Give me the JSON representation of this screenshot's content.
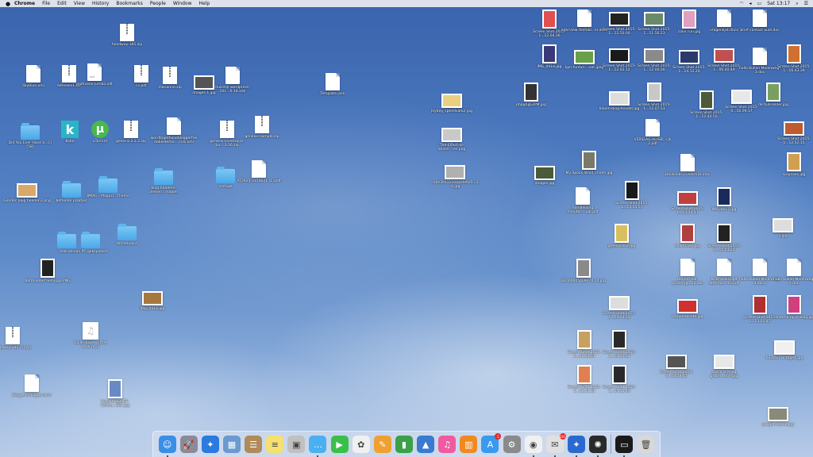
{
  "menubar": {
    "app": "Chrome",
    "items": [
      "File",
      "Edit",
      "View",
      "History",
      "Bookmarks",
      "People",
      "Window",
      "Help"
    ],
    "clock": "Sat 13:17"
  },
  "desktop_icons": [
    {
      "label": "headway-385.zip",
      "kind": "zip"
    },
    {
      "label": "SkyBlue.xmi",
      "kind": "doc"
    },
    {
      "label": "extlease1.xlk",
      "kind": "zip"
    },
    {
      "label": "motivatie jumbo.odt",
      "kind": "doc",
      "tag": "ODT"
    },
    {
      "label": "cv.pdf",
      "kind": "zip"
    },
    {
      "label": "marianne.zip",
      "kind": "zip"
    },
    {
      "label": "images-1.jpg",
      "kind": "shot",
      "color": "#555"
    },
    {
      "label": "huisstijl-wordpress-201...6-18.xml",
      "kind": "doc"
    },
    {
      "label": "Template.json",
      "kind": "doc"
    },
    {
      "label": "Did You Ever Have a...C) [58]",
      "kind": "folder"
    },
    {
      "label": "Kobo",
      "kind": "appk"
    },
    {
      "label": "uTorrent",
      "kind": "appu"
    },
    {
      "label": "genesis.2.2.2.zip",
      "kind": "zip"
    },
    {
      "label": "wordtogethonebloggerfeedabledemo-...cols.xml",
      "kind": "doc"
    },
    {
      "label": "genesis-lovettepro-ba....3.16.zip",
      "kind": "zip"
    },
    {
      "label": "genesis-sample.zip",
      "kind": "zip"
    },
    {
      "label": "AT2925-3150641 (1).pdf",
      "kind": "doc"
    },
    {
      "label": "Gondec blog header-2.png",
      "kind": "shot",
      "color": "#d9a86a"
    },
    {
      "label": "betaalde plaatjes",
      "kind": "folder"
    },
    {
      "label": "BMAG - Magazi...Theme",
      "kind": "folder"
    },
    {
      "label": "blog-headers-clemen...mables",
      "kind": "folder"
    },
    {
      "label": "vintage",
      "kind": "folder"
    },
    {
      "label": "Features",
      "kind": "folder"
    },
    {
      "label": "van PC gekopieerd",
      "kind": "folder"
    },
    {
      "label": "Whiteboard",
      "kind": "folder"
    },
    {
      "label": "betmoederfreetilogo.PNG",
      "kind": "tall",
      "color": "#222"
    },
    {
      "label": "IMG_0916.jpg",
      "kind": "shot",
      "color": "#a67840"
    },
    {
      "label": "headway-385 (1).zip",
      "kind": "zip"
    },
    {
      "label": "Collin Raye - Little Rock.mp3",
      "kind": "mp3"
    },
    {
      "label": "bloggennolöggen.json",
      "kind": "doc"
    },
    {
      "label": "kozol-9002067-Cartoo...881.jpg",
      "kind": "tall",
      "color": "#6a8ac7"
    },
    {
      "label": "jeyboy_speedvaltur.jpg",
      "kind": "shot",
      "color": "#e8d080"
    },
    {
      "label": "The-Effect-of-Shoes-...es.png",
      "kind": "shot",
      "color": "#c9c9c9"
    },
    {
      "label": "code3e01120440fe6e5...2.0.jpg",
      "kind": "shot",
      "color": "#b0b0b0"
    },
    {
      "label": "phpgRjJE2PM.jpg",
      "kind": "tall",
      "color": "#333"
    },
    {
      "label": "images.jpg",
      "kind": "shot",
      "color": "#4a5a3a"
    },
    {
      "label": "My Spoon Wind Chime.jpg",
      "kind": "tall",
      "color": "#7a7a6a"
    },
    {
      "label": "handleiding monitor-...uar.pdf",
      "kind": "doc"
    },
    {
      "label": "Screen Shot 2015-1...14.05.57",
      "kind": "tall",
      "color": "#1a1a1a"
    },
    {
      "label": "greenscene.jpg",
      "kind": "tall",
      "color": "#d8c060"
    },
    {
      "label": "82000005409070 10.jpg",
      "kind": "tall",
      "color": "#8a8a8a"
    },
    {
      "label": "Screen Shot 2015-1...12.04.36",
      "kind": "tall",
      "color": "#e05050"
    },
    {
      "label": "interview thefabl...er.docx",
      "kind": "doc"
    },
    {
      "label": "Screen Shot 2015-1...12.50.00",
      "kind": "shot",
      "color": "#222"
    },
    {
      "label": "Screen Shot 2015-1...11.56.23",
      "kind": "shot",
      "color": "#6a8a6a"
    },
    {
      "label": "color run.jpg",
      "kind": "tall",
      "color": "#e0a0c0"
    },
    {
      "label": "vragenlijst.docx",
      "kind": "doc"
    },
    {
      "label": "brief contact aust.doc",
      "kind": "doc"
    },
    {
      "label": "IMG_0918.jpg",
      "kind": "tall",
      "color": "#3a3a7a"
    },
    {
      "label": "kpn-funfun-...set.jpeg",
      "kind": "shot",
      "color": "#6aa04a"
    },
    {
      "label": "Screen Shot 2015-1...12.02.12",
      "kind": "shot",
      "color": "#1a1a1a"
    },
    {
      "label": "Screen Shot 2015-1...12.00.00",
      "kind": "shot",
      "color": "#8a8a8a"
    },
    {
      "label": "Screen Shot 2015-1...14.12.20",
      "kind": "shot",
      "color": "#2a3a6a"
    },
    {
      "label": "Screen Shot 2015-1...06.40.49",
      "kind": "shot",
      "color": "#c05050"
    },
    {
      "label": "hallo bullen Molenweg-3.doc",
      "kind": "doc"
    },
    {
      "label": "Screen Shot 2015-1...16.43.39",
      "kind": "tall",
      "color": "#d07030"
    },
    {
      "label": "bloom-blog-header.jpg",
      "kind": "shot",
      "color": "#ddd"
    },
    {
      "label": "Screen Shot 2015-1...12.07.53",
      "kind": "tall",
      "color": "#c8c8c8"
    },
    {
      "label": "Screen Shot 2015-1...12.40.50",
      "kind": "tall",
      "color": "#4a5a3a"
    },
    {
      "label": "Screen Shot 2015-0...16.09.17",
      "kind": "shot",
      "color": "#e8e8e8"
    },
    {
      "label": "de tijdsrelder.jpg",
      "kind": "tall",
      "color": "#7aa060"
    },
    {
      "label": "VERSLAG HUISB...cjk 2.pdf",
      "kind": "doc"
    },
    {
      "label": "Screen Shot 2015-1...12.52.15",
      "kind": "shot",
      "color": "#c05a30"
    },
    {
      "label": "Booklinks Eventeriis.xlsx",
      "kind": "doc"
    },
    {
      "label": "surprises.jpg",
      "kind": "tall",
      "color": "#d0a050"
    },
    {
      "label": "Screen Shot 2015-1...13.34.41",
      "kind": "shot",
      "color": "#c04040"
    },
    {
      "label": "IMG_0617.jpg",
      "kind": "tall",
      "color": "#1a2a5a"
    },
    {
      "label": "3.jpg",
      "kind": "shot",
      "color": "#ddd"
    },
    {
      "label": "elektricien.jpg",
      "kind": "tall",
      "color": "#b04040"
    },
    {
      "label": "Screen Shot 2015-1...15.01.25",
      "kind": "tall",
      "color": "#222"
    },
    {
      "label": "Bericht van bijschrijg...22.doc",
      "kind": "doc"
    },
    {
      "label": "brief gewijzigd leerroos...15.pdf",
      "kind": "doc"
    },
    {
      "label": "hallo bullen Molenweg-3.docx",
      "kind": "doc"
    },
    {
      "label": "hallo bullen Molenweg-3.doc",
      "kind": "doc"
    },
    {
      "label": "Screen Shot 2015-1...13.44.25",
      "kind": "shot",
      "color": "#ddd"
    },
    {
      "label": "zangerdachte.jpg",
      "kind": "shot",
      "color": "#d03030"
    },
    {
      "label": "Screen Shot 2015-1...13.02.45",
      "kind": "tall",
      "color": "#b03030"
    },
    {
      "label": "rootame op je blog.jpg",
      "kind": "tall",
      "color": "#d04080"
    },
    {
      "label": "Screen Shot 2015-1...11.20.51",
      "kind": "tall",
      "color": "#c8a060"
    },
    {
      "label": "Screen Shot 2015-1...14.25.34",
      "kind": "tall",
      "color": "#2a2a2a"
    },
    {
      "label": "Screen Shot 2015-0...16.18.47",
      "kind": "shot",
      "color": "#555"
    },
    {
      "label": "social sharing graph...h6h.jpg",
      "kind": "shot",
      "color": "#e8e8e8"
    },
    {
      "label": "huisstijl vintage4.jpg",
      "kind": "shot",
      "color": "#f0f0f0"
    },
    {
      "label": "Screen Shot 2015-1...11.21.31",
      "kind": "tall",
      "color": "#e08050"
    },
    {
      "label": "Screen Shot 2015-1...14.15.40",
      "kind": "tall",
      "color": "#2a2a2a"
    },
    {
      "label": "google desnie.jpg",
      "kind": "shot",
      "color": "#8a8a7a"
    }
  ],
  "dock": [
    {
      "name": "Finder",
      "color": "#3a8ee6",
      "glyph": "☺"
    },
    {
      "name": "Launchpad",
      "color": "#8a8a9a",
      "glyph": "🚀"
    },
    {
      "name": "Safari",
      "color": "#2a7ae0",
      "glyph": "✦"
    },
    {
      "name": "Preview",
      "color": "#6a9ad0",
      "glyph": "▦"
    },
    {
      "name": "Contacts",
      "color": "#b08a5a",
      "glyph": "☰"
    },
    {
      "name": "Notes",
      "color": "#f5e070",
      "glyph": "≡"
    },
    {
      "name": "Photo Booth",
      "color": "#c0c0c0",
      "glyph": "▣"
    },
    {
      "name": "Messages",
      "color": "#4ab0f0",
      "glyph": "…"
    },
    {
      "name": "FaceTime",
      "color": "#3ac04a",
      "glyph": "▶"
    },
    {
      "name": "Photos",
      "color": "#f0f0f0",
      "glyph": "✿"
    },
    {
      "name": "Pages",
      "color": "#f0a030",
      "glyph": "✎"
    },
    {
      "name": "Numbers",
      "color": "#3aa04a",
      "glyph": "▮"
    },
    {
      "name": "Keynote",
      "color": "#3a7ad0",
      "glyph": "▲"
    },
    {
      "name": "iTunes",
      "color": "#f05aa0",
      "glyph": "♫"
    },
    {
      "name": "iBooks",
      "color": "#f08a20",
      "glyph": "▥"
    },
    {
      "name": "App Store",
      "color": "#3a9af0",
      "glyph": "A",
      "badge": "5"
    },
    {
      "name": "System Preferences",
      "color": "#8a8a8a",
      "glyph": "⚙"
    },
    {
      "name": "Chrome",
      "color": "#f0f0f0",
      "glyph": "◉"
    },
    {
      "name": "Mail",
      "color": "#e0e0e0",
      "glyph": "✉",
      "badge": "201"
    },
    {
      "name": "Scrivener",
      "color": "#2a6ad0",
      "glyph": "✦"
    },
    {
      "name": "Activity Monitor",
      "color": "#2a2a2a",
      "glyph": "✺"
    },
    {
      "name": "Apple TV",
      "color": "#1a1a1a",
      "glyph": "▭"
    },
    {
      "name": "Trash",
      "color": "#d8d8d8",
      "glyph": "🗑"
    }
  ]
}
